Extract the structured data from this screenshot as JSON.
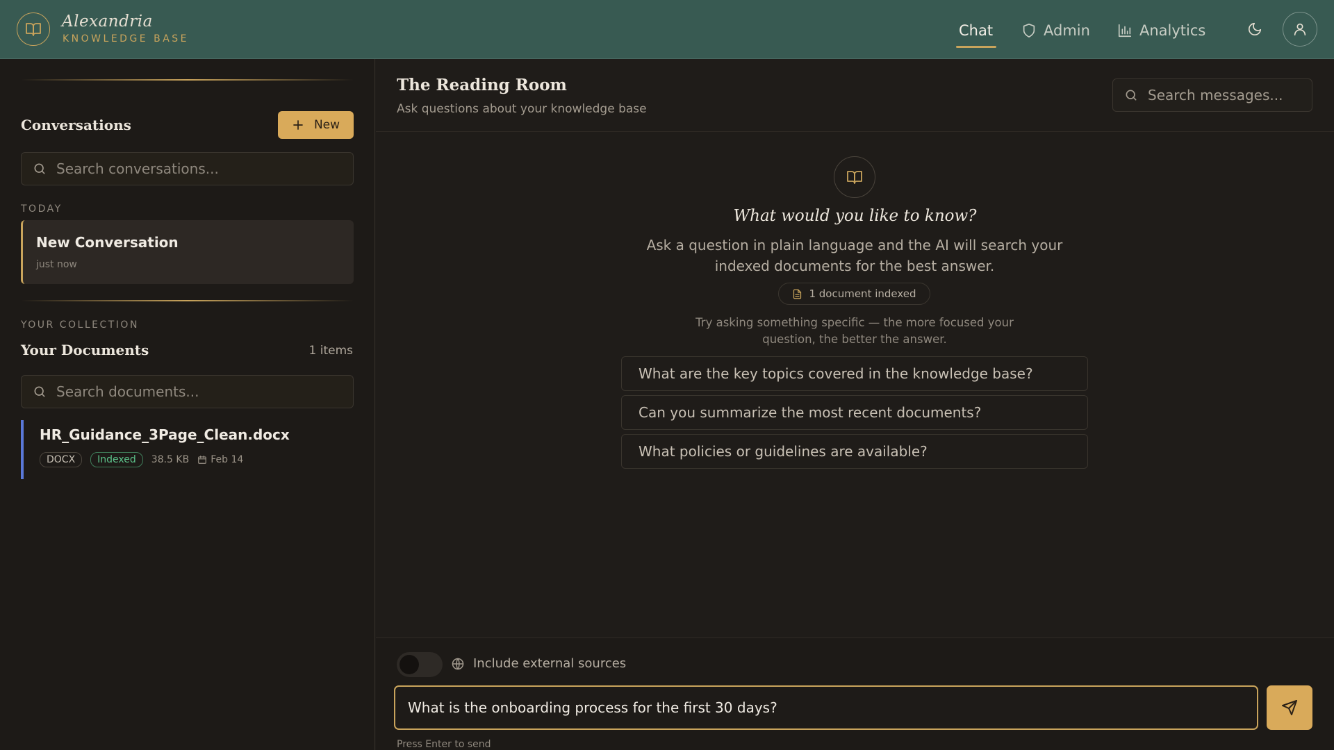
{
  "brand": {
    "name": "Alexandria",
    "subtitle": "KNOWLEDGE BASE"
  },
  "nav": {
    "chat": "Chat",
    "admin": "Admin",
    "analytics": "Analytics"
  },
  "sidebar": {
    "conversations_title": "Conversations",
    "new_button": "New",
    "search_conversations_placeholder": "Search conversations...",
    "today_label": "TODAY",
    "conversations": [
      {
        "title": "New Conversation",
        "time": "just now"
      }
    ],
    "collection_label": "YOUR COLLECTION",
    "documents_title": "Your Documents",
    "items_count": "1 items",
    "search_documents_placeholder": "Search documents...",
    "documents": [
      {
        "name": "HR_Guidance_3Page_Clean.docx",
        "type": "DOCX",
        "status": "Indexed",
        "size": "38.5 KB",
        "date": "Feb 14"
      }
    ]
  },
  "main": {
    "title": "The Reading Room",
    "subtitle": "Ask questions about your knowledge base",
    "search_messages_placeholder": "Search messages...",
    "empty_heading": "What would you like to know?",
    "empty_description": "Ask a question in plain language and the AI will search your indexed documents for the best answer.",
    "indexed_pill": "1 document indexed",
    "hint": "Try asking something specific — the more focused your question, the better the answer.",
    "suggestions": [
      "What are the key topics covered in the knowledge base?",
      "Can you summarize the most recent documents?",
      "What policies or guidelines are available?"
    ],
    "external_sources_label": "Include external sources",
    "external_sources_enabled": false,
    "input_value": "What is the onboarding process for the first 30 days?",
    "enter_hint": "Press Enter to send"
  },
  "colors": {
    "header_bg": "#385a52",
    "accent_gold": "#d9aa5a",
    "indexed_green": "#5cc28a",
    "doc_accent_blue": "#5a78d8",
    "background": "#1f1c19"
  },
  "icons": [
    "book-icon",
    "shield-icon",
    "bar-chart-icon",
    "moon-icon",
    "user-icon",
    "plus-icon",
    "search-icon",
    "file-icon",
    "calendar-icon",
    "globe-icon",
    "send-icon"
  ]
}
